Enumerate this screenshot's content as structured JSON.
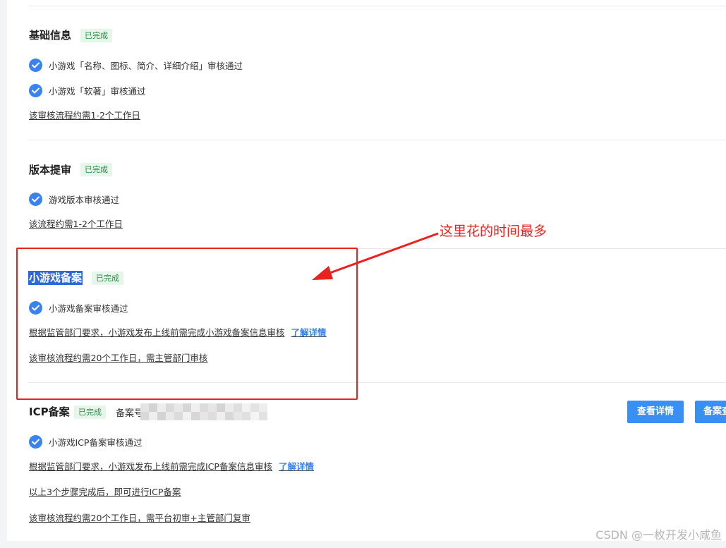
{
  "sections": {
    "basic": {
      "title": "基础信息",
      "badge": "已完成",
      "checks": [
        "小游戏「名称、图标、简介、详细介绍」审核通过",
        "小游戏「软著」审核通过"
      ],
      "note": "该审核流程约需1-2个工作日"
    },
    "version": {
      "title": "版本提审",
      "badge": "已完成",
      "checks": [
        "游戏版本审核通过"
      ],
      "note": "该流程约需1-2个工作日"
    },
    "filing": {
      "title": "小游戏备案",
      "badge": "已完成",
      "checks": [
        "小游戏备案审核通过"
      ],
      "note1": "根据监管部门要求，小游戏发布上线前需完成小游戏备案信息审核",
      "link": "了解详情",
      "note2": "该审核流程约需20个工作日，需主管部门审核"
    },
    "icp": {
      "title": "ICP备案",
      "badge": "已完成",
      "label": "备案号",
      "checks": [
        "小游戏ICP备案审核通过"
      ],
      "note1": "根据监管部门要求，小游戏发布上线前需完成ICP备案信息审核",
      "link": "了解详情",
      "note2": "以上3个步骤完成后，即可进行ICP备案",
      "note3": "该审核流程约需20个工作日，需平台初审+主管部门复审",
      "button_detail": "查看详情",
      "button_more": "备案查"
    }
  },
  "annotation": {
    "text": "这里花的时间最多",
    "color": "#e8221f"
  },
  "watermark": "CSDN @一枚开发小咸鱼",
  "colors": {
    "accent": "#3a82f0",
    "badge_bg": "#e6f6ea",
    "badge_text": "#2d8a45"
  }
}
